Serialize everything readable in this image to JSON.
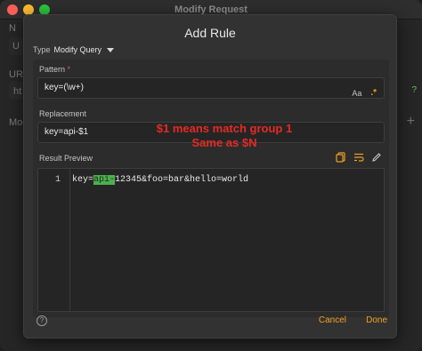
{
  "window": {
    "title": "Modify Request",
    "bg_labels": [
      "N",
      "U",
      "URL",
      "ht",
      "Mod"
    ],
    "bg_hint": "?"
  },
  "dialog": {
    "title": "Add Rule",
    "type_label": "Type",
    "type_value": "Modify Query",
    "pattern": {
      "label": "Pattern",
      "required_mark": "*",
      "value": "key=(\\w+)",
      "case_icon_text": "Aa",
      "regex_icon_text": ".*"
    },
    "replacement": {
      "label": "Replacement",
      "value": "key=api-$1"
    },
    "preview": {
      "label": "Result Preview",
      "line_number": "1",
      "prefix": "key=",
      "highlight": "api-",
      "suffix": "12345&foo=bar&hello=world"
    },
    "annotation": {
      "line1": "$1 means match group 1",
      "line2": "Same as $N"
    },
    "help_icon_text": "?",
    "cancel_label": "Cancel",
    "done_label": "Done"
  },
  "colors": {
    "accent": "#f0a020",
    "highlight": "#4caf50",
    "annotation": "#e52a23",
    "required": "#e05a4a"
  },
  "icons": [
    "copy-icon",
    "wrap-icon",
    "pencil-icon",
    "case-sensitive-icon",
    "regex-icon",
    "help-icon",
    "chevron-down-icon"
  ]
}
